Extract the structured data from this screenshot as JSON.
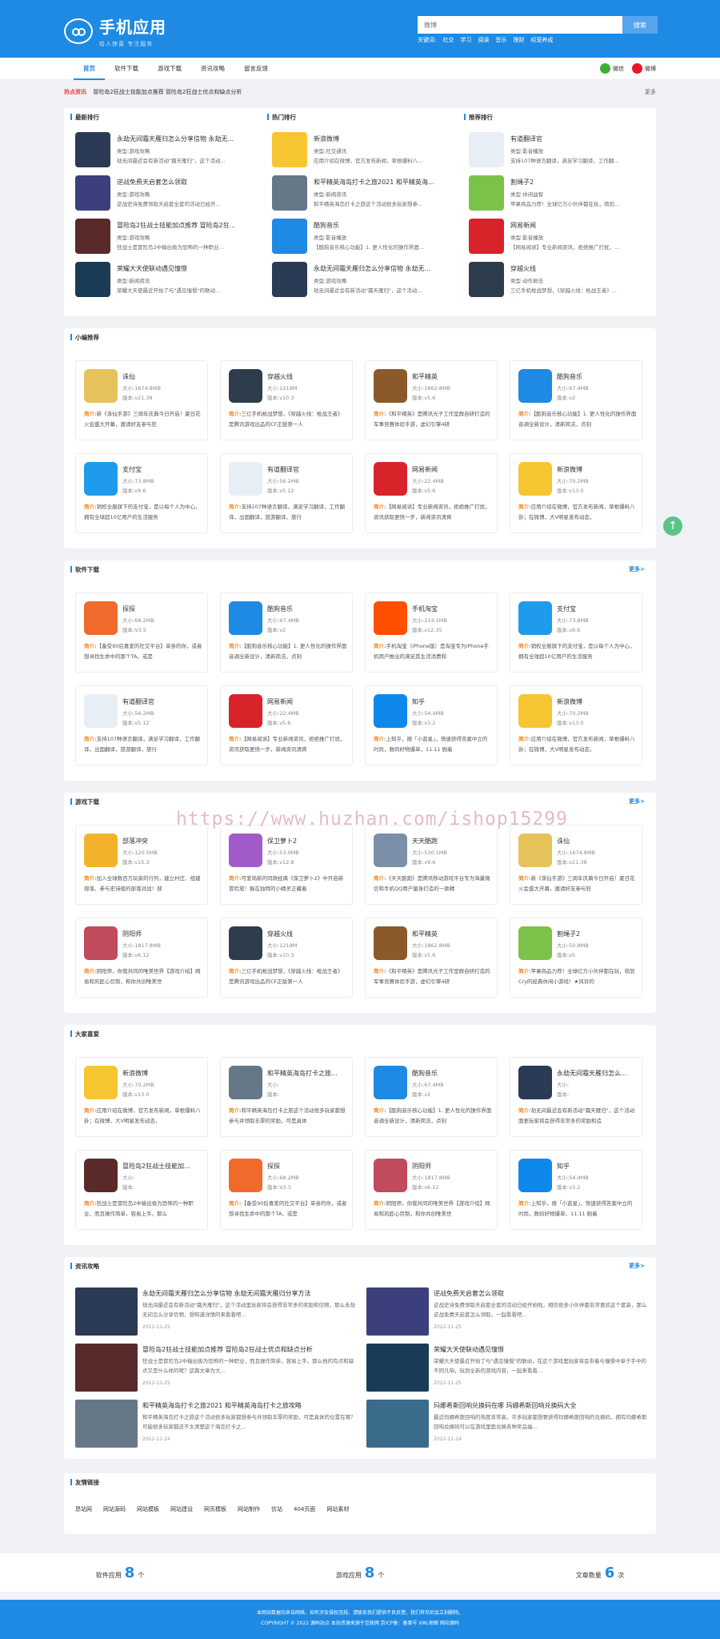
{
  "header": {
    "title": "手机应用",
    "slogan": "给人惊喜  专注服务",
    "search_placeholder": "微博",
    "search_button": "搜索",
    "keywords_label": "关键词:",
    "keywords": [
      "社交",
      "学习",
      "阅读",
      "音乐",
      "理财",
      "经营养成"
    ]
  },
  "nav": {
    "items": [
      "首页",
      "软件下载",
      "游戏下载",
      "资讯攻略",
      "留言反馈"
    ],
    "wechat": "微信",
    "weibo": "微博"
  },
  "hot": {
    "label": "热点资讯",
    "text": "冒险岛2狂战士技能加点推荐  冒险岛2狂战士优点和缺点分析",
    "more": "更多"
  },
  "rankings": [
    {
      "title": "最新排行",
      "items": [
        {
          "name": "永劫无间霜天雁归怎么分享信物 永劫无...",
          "type_label": "类型:",
          "type": "游戏攻略",
          "desc": "劫无间最近会有新活动\"霜天雁归\"，这个活动...",
          "color": "#2b3a55"
        },
        {
          "name": "逆战免费天启套怎么领取",
          "type_label": "类型:",
          "type": "游戏攻略",
          "desc": "逆战史诗免费领取天启套全套的活动已经开...",
          "color": "#3b3f7c"
        },
        {
          "name": "冒险岛2狂战士技能加点推荐 冒险岛2狂...",
          "type_label": "类型:",
          "type": "游戏攻略",
          "desc": "狂战士是冒险岛2中输出极为恐怖的一种职业...",
          "color": "#5a2a2a"
        },
        {
          "name": "荣耀大天使联动遇见憧憬",
          "type_label": "类型:",
          "type": "新闻资讯",
          "desc": "荣耀大天使最近开始了与\"遇见憧憬\"的联动...",
          "color": "#1a3b55"
        }
      ]
    },
    {
      "title": "热门排行",
      "items": [
        {
          "name": "新浪微博",
          "type_label": "类型:",
          "type": "社交通讯",
          "desc": "应用介绍在微博，官方发布新闻，草根爆料八...",
          "color": "#f7c531"
        },
        {
          "name": "和平精英海岛打卡之旅2021 和平精英海...",
          "type_label": "类型:",
          "type": "新闻资讯",
          "desc": "和平精英海岛打卡之旅这个活动很多玩家想参...",
          "color": "#667788"
        },
        {
          "name": "酷狗音乐",
          "type_label": "类型:",
          "type": "影音播放",
          "desc": "【酷狗音乐核心功能】1. 更人性化的操作界面...",
          "color": "#1e8ae3"
        },
        {
          "name": "永劫无间霜天雁归怎么分享信物 永劫无...",
          "type_label": "类型:",
          "type": "游戏攻略",
          "desc": "劫无间最近会有新活动\"霜天雁归\"，这个活动...",
          "color": "#2b3a55"
        }
      ]
    },
    {
      "title": "推荐排行",
      "items": [
        {
          "name": "有道翻译官",
          "type_label": "类型:",
          "type": "影音播放",
          "desc": "支持107种语言翻译，满足学习翻译，工作翻...",
          "color": "#e8eef5"
        },
        {
          "name": "割绳子2",
          "type_label": "类型:",
          "type": "休闲益智",
          "desc": "苹果商品力荐！全球亿万小伙伴都在玩，萌到...",
          "color": "#7bc24a"
        },
        {
          "name": "网易新闻",
          "type_label": "类型:",
          "type": "影音播放",
          "desc": "【网易阅读】专业新闻资讯，拒绝推广打扰，...",
          "color": "#d9232a"
        },
        {
          "name": "穿越火线",
          "type_label": "类型:",
          "type": "动作射击",
          "desc": "三亿手机枪战梦想，《穿越火线：枪战王者》...",
          "color": "#2e3d4c"
        }
      ]
    }
  ],
  "sections": [
    {
      "title": "小编推荐",
      "more": "",
      "items": [
        {
          "name": "诛仙",
          "size": "1674.8MB",
          "ver": "v21.38",
          "desc": "新《诛仙手游》三周年庆典今日开启！夏日花火会盛大开幕，邀请好友参与狂",
          "color": "#e6c25a"
        },
        {
          "name": "穿越火线",
          "size": "1219M",
          "ver": "v10.3",
          "desc": "三亿手机枪战梦想，《穿越火线：枪战王者》是腾讯游戏出品的CF正版第一人",
          "color": "#2e3d4c"
        },
        {
          "name": "和平精英",
          "size": "1862.8MB",
          "ver": "v5.6",
          "desc": "《和平精英》是腾讯光子工作室群自研打造的军事竞赛体验手游，虚幻引擎4研",
          "color": "#8a5a2b"
        },
        {
          "name": "酷狗音乐",
          "size": "67.4MB",
          "ver": "v2",
          "desc": "【酷狗音乐核心功能】1. 更人性化的操作界面音调全新设计，清新简洁，点刻",
          "color": "#1e8ae3"
        },
        {
          "name": "支付宝",
          "size": "73.8MB",
          "ver": "v9.6",
          "desc": "销权全服旗下的支付宝，是以每个人为中心，拥有全球超10亿用户的生活服务",
          "color": "#1e9ceb"
        },
        {
          "name": "有道翻译官",
          "size": "56.2MB",
          "ver": "v5.12",
          "desc": "支持107种语言翻译，满足学习翻译，工作翻译，出国翻译，旅游翻译，旅行",
          "color": "#e8eef5"
        },
        {
          "name": "网易新闻",
          "size": "22.4MB",
          "ver": "v5.6",
          "desc": "【网易阅读】专业新闻资讯，拒绝推广打扰，资讯获取更快一步，新闻资讯清爽",
          "color": "#d9232a"
        },
        {
          "name": "新浪微博",
          "size": "70.2MB",
          "ver": "v13.0",
          "desc": "应用介绍在微博，官方发布新闻，草根爆料八卦；在微博，大V明星发布动态，",
          "color": "#f7c531"
        }
      ]
    },
    {
      "title": "软件下载",
      "more": "更多>",
      "items": [
        {
          "name": "探探",
          "size": "68.2MB",
          "ver": "V3.5",
          "desc": "【备受90后喜爱的社交平台】单身的你，或者想寻找生命中的那个TA，或是",
          "color": "#f06a2c"
        },
        {
          "name": "酷狗音乐",
          "size": "67.4MB",
          "ver": "v2",
          "desc": "【酷狗音乐核心功能】1. 更人性化的操作界面音调全新设计，清新简洁，点刻",
          "color": "#1e8ae3"
        },
        {
          "name": "手机淘宝",
          "size": "114.1MB",
          "ver": "v12.35",
          "desc": "手机淘宝（iPhone版）是淘宝专为iPhone手机用户推出的满足其生活消费和",
          "color": "#ff5000"
        },
        {
          "name": "支付宝",
          "size": "73.8MB",
          "ver": "v9.6",
          "desc": "销权全服旗下的支付宝，是以每个人为中心，拥有全球超10亿用户的生活服务",
          "color": "#1e9ceb"
        },
        {
          "name": "有道翻译官",
          "size": "56.2MB",
          "ver": "v5.12",
          "desc": "支持107种语言翻译，满足学习翻译，工作翻译，出国翻译，旅游翻译，旅行",
          "color": "#e8eef5"
        },
        {
          "name": "网易新闻",
          "size": "22.4MB",
          "ver": "v5.6",
          "desc": "【网易阅读】专业新闻资讯，拒绝推广打扰，资讯获取更快一步，新闻资讯清爽",
          "color": "#d9232a"
        },
        {
          "name": "知乎",
          "size": "54.4MB",
          "ver": "v3.2",
          "desc": "上知乎，搜「小蓝星」，快速获得答案中立的时尚，数码好物爆单，11.11 剧着",
          "color": "#0f88eb"
        },
        {
          "name": "新浪微博",
          "size": "70.2MB",
          "ver": "v13.0",
          "desc": "应用介绍在微博，官方发布新闻，草根爆料八卦；在微博，大V明星发布动态，",
          "color": "#f7c531"
        }
      ]
    },
    {
      "title": "游戏下载",
      "more": "更多>",
      "items": [
        {
          "name": "部落冲突",
          "size": "120.5MB",
          "ver": "v15.3",
          "desc": "加入全球数百万玩家的行列，建立村庄、组建部落、参与史诗般的部落对战！部",
          "color": "#f2b22a"
        },
        {
          "name": "保卫萝卜2",
          "size": "53.0MB",
          "ver": "v12.8",
          "desc": "可爱萌新的同款经典《保卫萝卜2》中开启新冒险旅！躲在独特的小精灵正藏着",
          "color": "#a15cc9"
        },
        {
          "name": "天天酷跑",
          "size": "530.1MB",
          "ver": "v9.6",
          "desc": "《天天酷跑》是腾讯移动游戏平台专为海量微信和手机QQ用户量身打造的一款精",
          "color": "#7c8fa8"
        },
        {
          "name": "诛仙",
          "size": "1674.8MB",
          "ver": "v21.38",
          "desc": "新《诛仙手游》三周年庆典今日开启！夏日花火会盛大开幕，邀请好友参与狂",
          "color": "#e6c25a"
        },
        {
          "name": "阴阳师",
          "size": "1817.8MB",
          "ver": "v6.12",
          "desc": "阴阳师，你我共同的唯美世界【游戏介绍】网易和风匠心巨制，和你共创唯美世",
          "color": "#c14a5c"
        },
        {
          "name": "穿越火线",
          "size": "1219M",
          "ver": "v10.3",
          "desc": "三亿手机枪战梦想，《穿越火线：枪战王者》是腾讯游戏出品的CF正版第一人",
          "color": "#2e3d4c"
        },
        {
          "name": "和平精英",
          "size": "1862.8MB",
          "ver": "v5.6",
          "desc": "《和平精英》是腾讯光子工作室群自研打造的军事竞赛体验手游，虚幻引擎4研",
          "color": "#8a5a2b"
        },
        {
          "name": "割绳子2",
          "size": "50.8MB",
          "ver": "v5",
          "desc": "苹果商品力荐！全球亿万小伙伴都在玩，萌到Cry的经典休闲小游戏！★风铃的",
          "color": "#7bc24a"
        }
      ]
    },
    {
      "title": "大家喜爱",
      "more": "",
      "items": [
        {
          "name": "新浪微博",
          "size": "70.2MB",
          "ver": "v13.0",
          "desc": "应用介绍在微博，官方发布新闻，草根爆料八卦；在微博，大V明星发布动态，",
          "color": "#f7c531"
        },
        {
          "name": "和平精英海岛打卡之旅...",
          "size": "",
          "ver": "",
          "desc": "和平精英海岛打卡之旅这个活动很多玩家都想参与并领取丰厚的奖励，可是具体",
          "color": "#667788"
        },
        {
          "name": "酷狗音乐",
          "size": "67.4MB",
          "ver": "v2",
          "desc": "【酷狗音乐核心功能】1. 更人性化的操作界面音调全新设计，清新简洁，点刻",
          "color": "#1e8ae3"
        },
        {
          "name": "永劫无间霜天雁归怎么...",
          "size": "",
          "ver": "",
          "desc": "劫无间最近会有新活动\"霜天雁归\"，这个活动面更玩家将会获得非常多的奖励和造",
          "color": "#2b3a55"
        },
        {
          "name": "冒险岛2狂战士技能加...",
          "size": "",
          "ver": "",
          "desc": "狂战士是冒险岛2中输出极为恐怖的一种职业，而且操作简单，容易上手。那么",
          "color": "#5a2a2a"
        },
        {
          "name": "探探",
          "size": "68.2MB",
          "ver": "V3.5",
          "desc": "【备受90后喜爱的社交平台】单身的你，或者想寻找生命中的那个TA，或是",
          "color": "#f06a2c"
        },
        {
          "name": "阴阳师",
          "size": "1817.8MB",
          "ver": "v6.12",
          "desc": "阴阳师，你我共同的唯美世界【游戏介绍】网易和风匠心巨制，和你共创唯美世",
          "color": "#c14a5c"
        },
        {
          "name": "知乎",
          "size": "54.4MB",
          "ver": "v3.2",
          "desc": "上知乎，搜「小蓝星」，快速获得答案中立的时尚，数码好物爆单，11.11 剧着",
          "color": "#0f88eb"
        }
      ]
    }
  ],
  "labels": {
    "size": "大小:",
    "ver": "版本:",
    "intro": "简介:"
  },
  "news": {
    "title": "资讯攻略",
    "more": "更多>",
    "items": [
      {
        "title": "永劫无间霜天雁归怎么分享信物 永劫无间霜天雁归分享方法",
        "desc": "劫无间最近会有新活动\"霜天雁归\"，这个活动里玩家将会获得非常多的奖励和信物，那么永劫无间怎么分享信物，想知道详情的来看看吧...",
        "date": "2022-11-25",
        "color": "#2b3a55"
      },
      {
        "title": "逆战免费天启套怎么领取",
        "desc": "逆战史诗免费领取天启套全套的活动已经开始啦，相信很多小伙伴都非常喜欢这个套装，那么逆战免费天启套怎么领取，一起看看吧...",
        "date": "2022-11-25",
        "color": "#3b3f7c"
      },
      {
        "title": "冒险岛2狂战士技能加点推荐 冒险岛2狂战士优点和缺点分析",
        "desc": "狂战士是冒险岛2中输出极为恐怖的一种职业，而且操作简单，容易上手。那么他的有点和缺点又是什么样的呢？这篇文章为大...",
        "date": "2022-11-25",
        "color": "#5a2a2a"
      },
      {
        "title": "荣耀大天使联动遇见憧憬",
        "desc": "荣耀大天使最近开始了与\"遇见憧憬\"的联动，在这个游戏里玩家将会带着与憧憬中单于手中的不同凡响，玩到全新的游戏内容，一起来看看...",
        "date": "2022-11-25",
        "color": "#1a3b55"
      },
      {
        "title": "和平精英海岛打卡之旅2021 和平精英海岛打卡之旅攻略",
        "desc": "和平精英海岛打卡之旅这个活动很多玩家都想参与并领取丰厚的奖励，可是具体的位置在哪？可能很多玩家都还不太清楚这个海岛打卡之...",
        "date": "2022-11-24",
        "color": "#667788"
      },
      {
        "title": "玛娜希斯回响兑换码在哪 玛娜希斯回响兑换码大全",
        "desc": "最近玛娜希斯回响的热度非常高，许多玩家都想要获得玛娜希斯回响的兑换码，拥有玛娜希斯回响兑换码可以在游戏里面兑换各种奖品福...",
        "date": "2022-11-24",
        "color": "#3a6b8a"
      }
    ]
  },
  "links": {
    "title": "友情链接",
    "items": [
      "昂站网",
      "网站源码",
      "网站模板",
      "网站建设",
      "网页模板",
      "网站制作",
      "仿站",
      "404页面",
      "网站素材"
    ]
  },
  "stats": [
    {
      "label": "软件应用",
      "value": "8",
      "unit": "个"
    },
    {
      "label": "游戏应用",
      "value": "8",
      "unit": "个"
    },
    {
      "label": "文章数量",
      "value": "6",
      "unit": "次"
    }
  ],
  "footer": {
    "line1": "本网站数据均来自网络，如有涉及侵权违规，请联系我们提供不良反馈，我们将尽后会立刻删除。",
    "line2": "COPYRIGHT © 2022 源码站点 本站资源来源于互联网 京ICP备：备案号 XML地图 网站源码"
  },
  "watermark": "https://www.huzhan.com/ishop15299",
  "gotop": "↑"
}
